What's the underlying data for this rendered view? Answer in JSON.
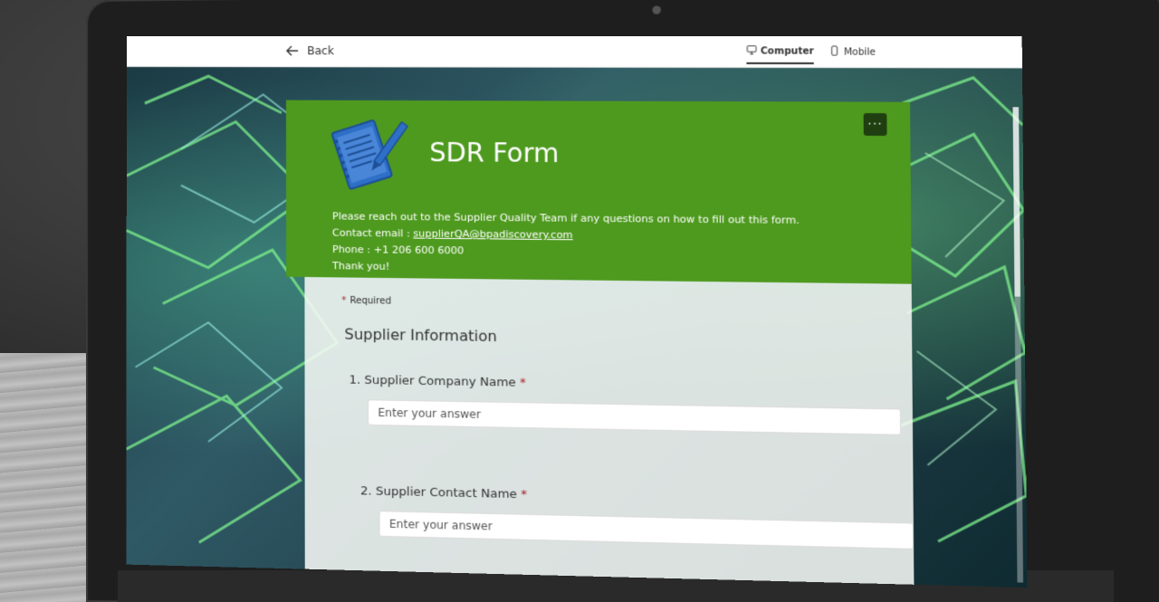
{
  "topbar": {
    "back_label": "Back",
    "views": [
      {
        "label": "Computer",
        "active": true
      },
      {
        "label": "Mobile",
        "active": false
      }
    ]
  },
  "form": {
    "title": "SDR Form",
    "more_label": "···",
    "description": {
      "line1": "Please reach out to the Supplier Quality Team if any questions on how to fill out this form.",
      "contact_prefix": "Contact email : ",
      "email": "supplierQA@bpadiscovery.com",
      "phone": "Phone : +1 206 600 6000",
      "thanks": "Thank you!"
    },
    "required_label": "Required",
    "section_title": "Supplier Information",
    "questions": [
      {
        "label": "1. Supplier Company Name",
        "required": "*",
        "placeholder": "Enter your answer"
      },
      {
        "label": "2. Supplier Contact Name",
        "required": "*",
        "placeholder": "Enter your answer"
      }
    ]
  },
  "colors": {
    "header_green": "#4e9a1f",
    "required_red": "#a4262c",
    "logo_blue": "#2e6fc7"
  }
}
